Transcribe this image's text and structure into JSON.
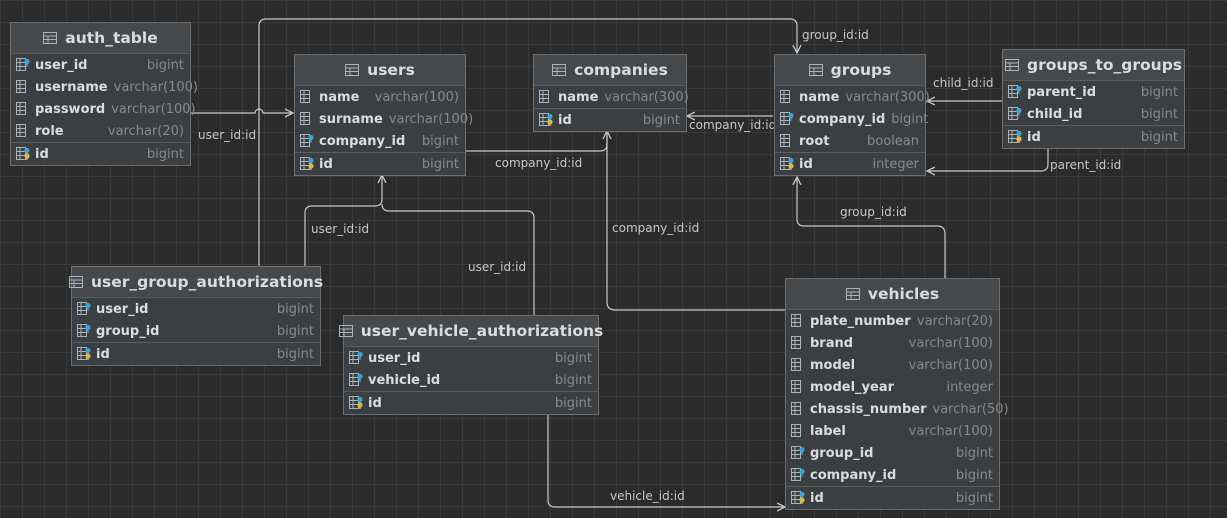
{
  "tables": {
    "auth_table": {
      "name": "auth_table",
      "columns": [
        {
          "name": "user_id",
          "type": "bigint"
        },
        {
          "name": "username",
          "type": "varchar(100)"
        },
        {
          "name": "password",
          "type": "varchar(100)"
        },
        {
          "name": "role",
          "type": "varchar(20)"
        }
      ],
      "keys": [
        {
          "name": "id",
          "type": "bigint"
        }
      ]
    },
    "users": {
      "name": "users",
      "columns": [
        {
          "name": "name",
          "type": "varchar(100)"
        },
        {
          "name": "surname",
          "type": "varchar(100)"
        },
        {
          "name": "company_id",
          "type": "bigint"
        }
      ],
      "keys": [
        {
          "name": "id",
          "type": "bigint"
        }
      ]
    },
    "companies": {
      "name": "companies",
      "columns": [
        {
          "name": "name",
          "type": "varchar(300)"
        }
      ],
      "keys": [
        {
          "name": "id",
          "type": "bigint"
        }
      ]
    },
    "groups": {
      "name": "groups",
      "columns": [
        {
          "name": "name",
          "type": "varchar(300)"
        },
        {
          "name": "company_id",
          "type": "bigint"
        },
        {
          "name": "root",
          "type": "boolean"
        }
      ],
      "keys": [
        {
          "name": "id",
          "type": "integer"
        }
      ]
    },
    "groups_to_groups": {
      "name": "groups_to_groups",
      "columns": [
        {
          "name": "parent_id",
          "type": "bigint"
        },
        {
          "name": "child_id",
          "type": "bigint"
        }
      ],
      "keys": [
        {
          "name": "id",
          "type": "bigint"
        }
      ]
    },
    "user_group_authorizations": {
      "name": "user_group_authorizations",
      "columns": [
        {
          "name": "user_id",
          "type": "bigint"
        },
        {
          "name": "group_id",
          "type": "bigint"
        }
      ],
      "keys": [
        {
          "name": "id",
          "type": "bigint"
        }
      ]
    },
    "user_vehicle_authorizations": {
      "name": "user_vehicle_authorizations",
      "columns": [
        {
          "name": "user_id",
          "type": "bigint"
        },
        {
          "name": "vehicle_id",
          "type": "bigint"
        }
      ],
      "keys": [
        {
          "name": "id",
          "type": "bigint"
        }
      ]
    },
    "vehicles": {
      "name": "vehicles",
      "columns": [
        {
          "name": "plate_number",
          "type": "varchar(20)"
        },
        {
          "name": "brand",
          "type": "varchar(100)"
        },
        {
          "name": "model",
          "type": "varchar(100)"
        },
        {
          "name": "model_year",
          "type": "integer"
        },
        {
          "name": "chassis_number",
          "type": "varchar(50)"
        },
        {
          "name": "label",
          "type": "varchar(100)"
        },
        {
          "name": "group_id",
          "type": "bigint"
        },
        {
          "name": "company_id",
          "type": "bigint"
        }
      ],
      "keys": [
        {
          "name": "id",
          "type": "bigint"
        }
      ]
    }
  },
  "relations": {
    "auth_users": "user_id:id",
    "uga_groups": "group_id:id",
    "users_companies": "company_id:id",
    "groups_companies": "company_id:id",
    "g2g_child": "child_id:id",
    "g2g_parent": "parent_id:id",
    "uga_users": "user_id:id",
    "uva_users": "user_id:id",
    "vehicles_groups": "group_id:id",
    "vehicles_companies": "company_id:id",
    "uva_vehicles": "vehicle_id:id"
  },
  "colors": {
    "canvas": "#2b2b2b",
    "grid": "#3a3a3a",
    "table_body": "#3c3f41",
    "table_header": "#45494b",
    "connector": "#c8c8c8",
    "column_name": "#dcdcdc",
    "column_type": "#8a8a8a",
    "key_icon": "#e0b84a",
    "fk_icon": "#3aa3d8"
  }
}
